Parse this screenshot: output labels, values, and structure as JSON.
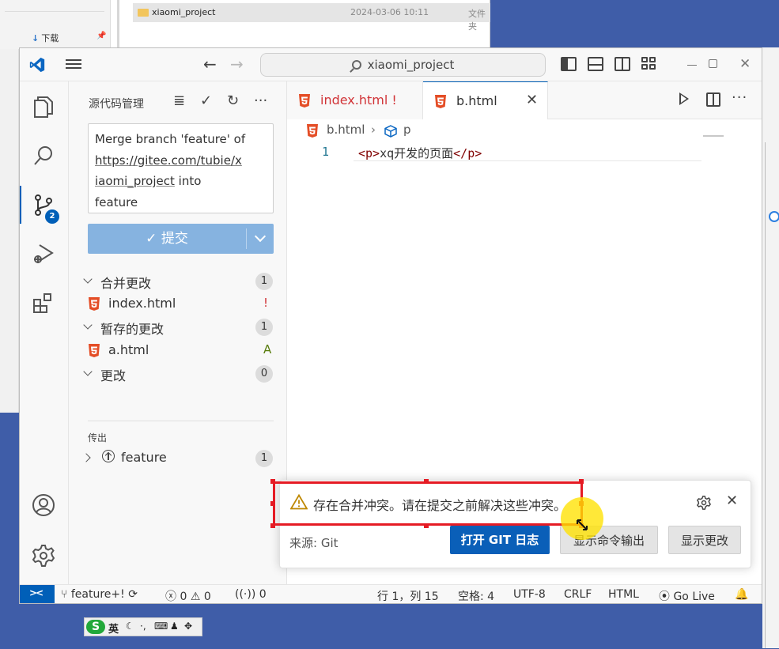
{
  "background": {
    "explorer": {
      "downloads_label": "下载",
      "folder_name": "xiaomi_project",
      "folder_date": "2024-03-06 10:11",
      "folder_type": "文件夹"
    }
  },
  "titlebar": {
    "search_text": "xiaomi_project"
  },
  "activity_bar": {
    "scm_badge": "2"
  },
  "sidebar": {
    "title": "源代码管理",
    "commit_message_lines": [
      "Merge branch 'feature' of",
      "https://gitee.com/tubie/x",
      "iaomi_project",
      "into",
      "feature"
    ],
    "commit_button": "✓ 提交",
    "sections": [
      {
        "label": "合并更改",
        "count": "1",
        "file": "index.html",
        "status": "!"
      },
      {
        "label": "暂存的更改",
        "count": "1",
        "file": "a.html",
        "status": "A"
      },
      {
        "label": "更改",
        "count": "0"
      }
    ],
    "outgoing": {
      "header": "传出",
      "branch": "feature",
      "count": "1"
    }
  },
  "editor": {
    "tabs": [
      {
        "label": "index.html !",
        "active": false
      },
      {
        "label": "b.html",
        "active": true
      }
    ],
    "breadcrumb": {
      "file": "b.html",
      "symbol": "p"
    },
    "lines": [
      {
        "number": "1",
        "open_tag": "<p>",
        "content": "xq开发的页面",
        "close_tag": "</p>"
      }
    ]
  },
  "notification": {
    "message": "存在合并冲突。请在提交之前解决这些冲突。",
    "source": "来源: Git",
    "buttons": [
      "打开 GIT 日志",
      "显示命令输出",
      "显示更改"
    ]
  },
  "statusbar": {
    "branch": "feature+!",
    "errors": "0",
    "warnings": "0",
    "ports": "0",
    "position": "行 1，列 15",
    "spaces": "空格: 4",
    "encoding": "UTF-8",
    "eol": "CRLF",
    "language": "HTML",
    "golive": "Go Live"
  },
  "ime": {
    "logo": "S",
    "mode": "英"
  },
  "colors": {
    "accent": "#005fb8",
    "html_icon": "#e44d26",
    "highlight_box": "#e51b24"
  }
}
